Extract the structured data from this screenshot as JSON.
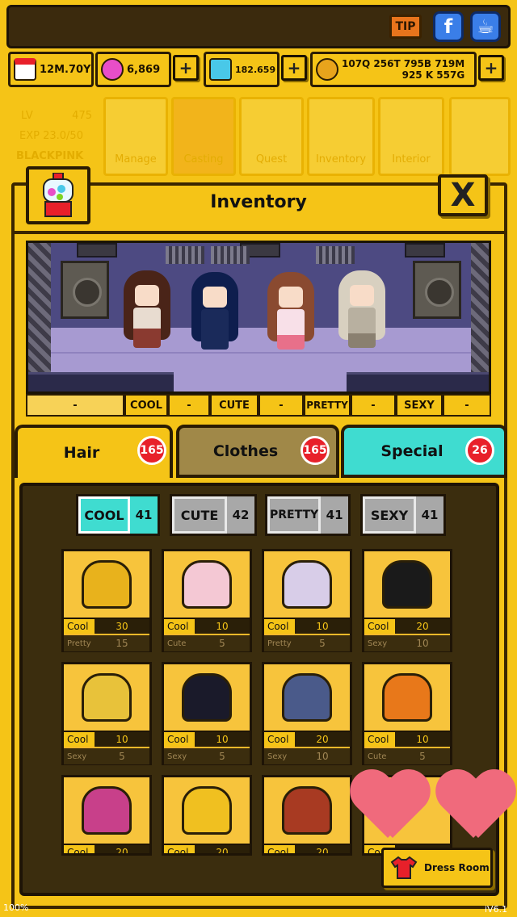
{
  "top": {
    "tip_label": "TIP",
    "fb_label": "f",
    "chat_label": "☕"
  },
  "currency": [
    {
      "name": "calendar",
      "value": "12M.70Y",
      "plus": false
    },
    {
      "name": "candy",
      "value": "6,869",
      "plus": true
    },
    {
      "name": "diamond",
      "value": "182.659",
      "plus": true
    },
    {
      "name": "coin",
      "value": "107Q 256T 795B 719M\n925 K 557G",
      "plus": true
    }
  ],
  "bg_menu": {
    "lv_label": "LV",
    "lv_value": "475",
    "exp": "EXP 23.0/50",
    "group": "BLACKPINK",
    "items": [
      "Manage",
      "Casting",
      "Quest",
      "Inventory",
      "Interior"
    ]
  },
  "panel": {
    "title": "Inventory",
    "close_label": "X"
  },
  "stage_tabs": [
    "-",
    "COOL",
    "-",
    "CUTE",
    "-",
    "PRETTY",
    "-",
    "SEXY",
    "-"
  ],
  "categories": [
    {
      "label": "Hair",
      "count": "165",
      "color": "#f5c417"
    },
    {
      "label": "Clothes",
      "count": "165",
      "color": "#a08848"
    },
    {
      "label": "Special",
      "count": "26",
      "color": "#3fdcd0"
    }
  ],
  "filters": [
    {
      "label": "COOL",
      "count": "41",
      "color": "#3fdcd0"
    },
    {
      "label": "CUTE",
      "count": "42",
      "color": "#a8a8a8"
    },
    {
      "label": "PRETTY",
      "count": "41",
      "color": "#a8a8a8"
    },
    {
      "label": "SEXY",
      "count": "41",
      "color": "#a8a8a8"
    }
  ],
  "items": [
    {
      "icon": "long-blonde-hair-icon",
      "color": "#e8b21c",
      "stat1": "Cool",
      "val1": "30",
      "stat2": "Pretty",
      "val2": "15"
    },
    {
      "icon": "pink-bob-hair-icon",
      "color": "#f4c8d4",
      "stat1": "Cool",
      "val1": "10",
      "stat2": "Cute",
      "val2": "5"
    },
    {
      "icon": "lavender-long-hair-icon",
      "color": "#d8cde8",
      "stat1": "Cool",
      "val1": "10",
      "stat2": "Pretty",
      "val2": "5"
    },
    {
      "icon": "black-bun-hair-icon",
      "color": "#1a1a1a",
      "stat1": "Cool",
      "val1": "20",
      "stat2": "Sexy",
      "val2": "10"
    },
    {
      "icon": "yellow-ponytail-hair-icon",
      "color": "#e8c23a",
      "stat1": "Cool",
      "val1": "10",
      "stat2": "Sexy",
      "val2": "5"
    },
    {
      "icon": "black-blue-hair-icon",
      "color": "#1a1a2a",
      "stat1": "Cool",
      "val1": "10",
      "stat2": "Sexy",
      "val2": "5"
    },
    {
      "icon": "navy-short-hair-icon",
      "color": "#4a5a8a",
      "stat1": "Cool",
      "val1": "20",
      "stat2": "Sexy",
      "val2": "10"
    },
    {
      "icon": "orange-hair-icon",
      "color": "#e8781a",
      "stat1": "Cool",
      "val1": "10",
      "stat2": "Cute",
      "val2": "5"
    },
    {
      "icon": "magenta-hair-icon",
      "color": "#c8408a",
      "stat1": "Cool",
      "val1": "20",
      "stat2": "",
      "val2": ""
    },
    {
      "icon": "gold-spiky-hair-icon",
      "color": "#f0c020",
      "stat1": "Cool",
      "val1": "20",
      "stat2": "",
      "val2": ""
    },
    {
      "icon": "red-brown-hair-icon",
      "color": "#a83a22",
      "stat1": "Cool",
      "val1": "20",
      "stat2": "",
      "val2": ""
    },
    {
      "icon": "partial-hair-icon",
      "color": "#f5b92a",
      "stat1": "Co",
      "val1": "",
      "stat2": "",
      "val2": ""
    }
  ],
  "dress_room_label": "Dress Room",
  "footer": {
    "left": "100%",
    "right": "iV6.1"
  },
  "colors": {
    "gold": "#f5c417",
    "dark_brown": "#3b2d0e",
    "cyan": "#3fdcd0",
    "badge_red": "#e8202a"
  }
}
